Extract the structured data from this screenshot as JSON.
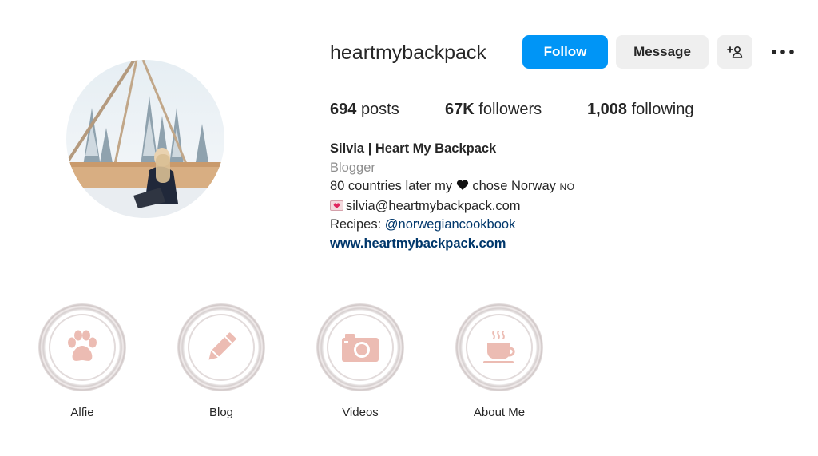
{
  "profile": {
    "username": "heartmybackpack",
    "avatar_alt": "profile-photo"
  },
  "actions": {
    "follow_label": "Follow",
    "message_label": "Message",
    "suggest_icon": "add-person-icon",
    "more_icon": "more-options-icon"
  },
  "stats": {
    "posts_count": "694",
    "posts_label": "posts",
    "followers_count": "67K",
    "followers_label": "followers",
    "following_count": "1,008",
    "following_label": "following"
  },
  "bio": {
    "full_name": "Silvia | Heart My Backpack",
    "category": "Blogger",
    "line1_before": "80 countries later my",
    "line1_after": "chose Norway",
    "line1_flag": "NO",
    "email": "silvia@heartmybackpack.com",
    "recipes_prefix": "Recipes:",
    "recipes_mention": "@norwegiancookbook",
    "website": "www.heartmybackpack.com"
  },
  "highlights": [
    {
      "label": "Alfie",
      "icon": "paw-icon"
    },
    {
      "label": "Blog",
      "icon": "pencil-icon"
    },
    {
      "label": "Videos",
      "icon": "camera-icon"
    },
    {
      "label": "About Me",
      "icon": "coffee-cup-icon"
    }
  ],
  "colors": {
    "accent": "#0095f6",
    "highlight_icon": "#ecbcb3",
    "link": "#00376b"
  }
}
